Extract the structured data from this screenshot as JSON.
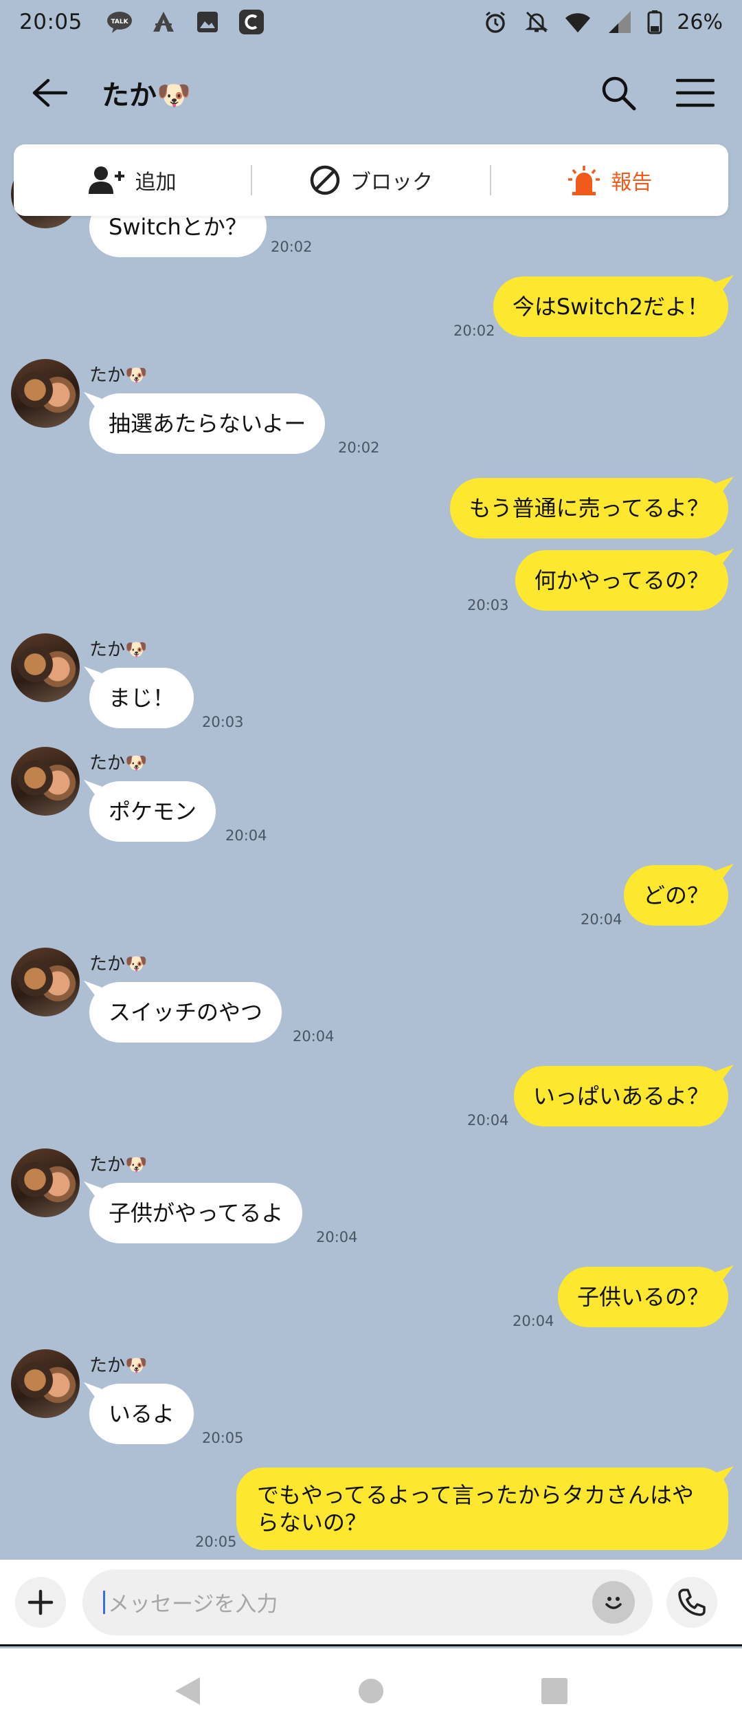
{
  "status_bar": {
    "time": "20:05",
    "left_icons": [
      "line-talk-icon",
      "tent-icon",
      "gallery-icon",
      "c-app-icon"
    ],
    "right_icons": [
      "alarm-icon",
      "notification-off-icon",
      "wifi-icon",
      "signal-icon",
      "battery-icon"
    ],
    "battery": "26%"
  },
  "header": {
    "title": "たか🐶"
  },
  "action_bar": {
    "add_label": "追加",
    "block_label": "ブロック",
    "report_label": "報告",
    "report_color": "#f05a1a"
  },
  "colors": {
    "background": "#aebfd3",
    "incoming_bubble": "#ffffff",
    "outgoing_bubble": "#fde82f"
  },
  "messages": [
    {
      "from": "them",
      "sender": "",
      "text": "Switchとか？",
      "time": "20:02"
    },
    {
      "from": "me",
      "text": "今はSwitch2だよ！",
      "time": "20:02"
    },
    {
      "from": "them",
      "sender": "たか🐶",
      "text": "抽選あたらないよー",
      "time": "20:02"
    },
    {
      "from": "me",
      "text": "もう普通に売ってるよ？",
      "time": ""
    },
    {
      "from": "me",
      "text": "何かやってるの？",
      "time": "20:03"
    },
    {
      "from": "them",
      "sender": "たか🐶",
      "text": "まじ！",
      "time": "20:03"
    },
    {
      "from": "them",
      "sender": "たか🐶",
      "text": "ポケモン",
      "time": "20:04"
    },
    {
      "from": "me",
      "text": "どの？",
      "time": "20:04"
    },
    {
      "from": "them",
      "sender": "たか🐶",
      "text": "スイッチのやつ",
      "time": "20:04"
    },
    {
      "from": "me",
      "text": "いっぱいあるよ？",
      "time": "20:04"
    },
    {
      "from": "them",
      "sender": "たか🐶",
      "text": "子供がやってるよ",
      "time": "20:04"
    },
    {
      "from": "me",
      "text": "子供いるの？",
      "time": "20:04"
    },
    {
      "from": "them",
      "sender": "たか🐶",
      "text": "いるよ",
      "time": "20:05"
    },
    {
      "from": "me",
      "text": "でもやってるよって言ったからタカさんはやらないの？",
      "time": "20:05"
    }
  ],
  "input_bar": {
    "placeholder": "メッセージを入力"
  }
}
